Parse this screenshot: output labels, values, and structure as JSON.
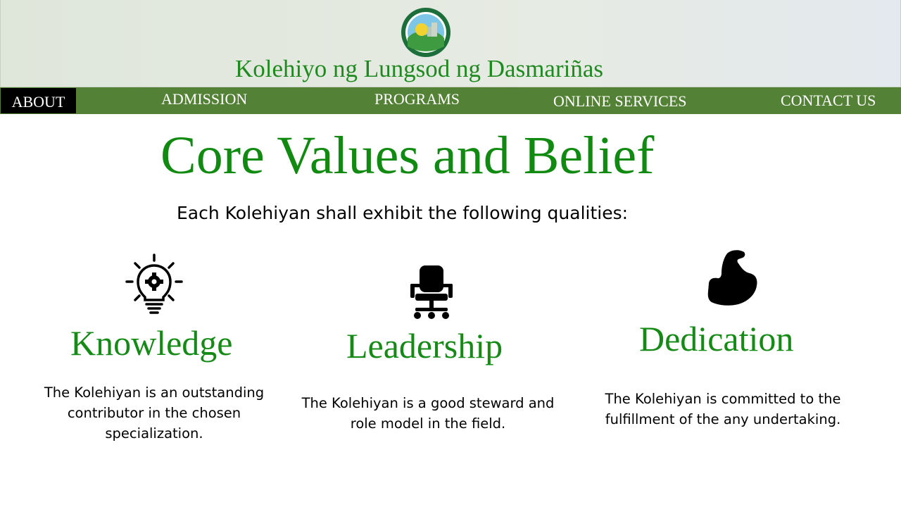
{
  "header": {
    "seal_icon": "city-seal-icon",
    "site_title": "Kolehiyo ng Lungsod ng Dasmariñas"
  },
  "nav": {
    "items": [
      {
        "label": "ABOUT",
        "active": true
      },
      {
        "label": "ADMISSION",
        "active": false
      },
      {
        "label": "PROGRAMS",
        "active": false
      },
      {
        "label": "ONLINE SERVICES",
        "active": false
      },
      {
        "label": "CONTACT US",
        "active": false
      }
    ],
    "active_color": "#000000",
    "bar_color": "#538135"
  },
  "main": {
    "title": "Core Values and Belief",
    "subtitle": "Each Kolehiyan shall exhibit the following qualities:",
    "values": [
      {
        "icon": "lightbulb-gear-icon",
        "name": "Knowledge",
        "desc_lines": [
          "The Kolehiyan is an outstanding",
          "contributor in the chosen",
          "specialization."
        ]
      },
      {
        "icon": "office-chair-icon",
        "name": "Leadership",
        "desc_lines": [
          "The Kolehiyan is a good steward and",
          "role model in the field."
        ]
      },
      {
        "icon": "flexed-arm-icon",
        "name": "Dedication",
        "desc_lines": [
          "The Kolehiyan is committed to the",
          "fulfillment of the any undertaking."
        ]
      }
    ],
    "accent_color": "#118a11"
  }
}
